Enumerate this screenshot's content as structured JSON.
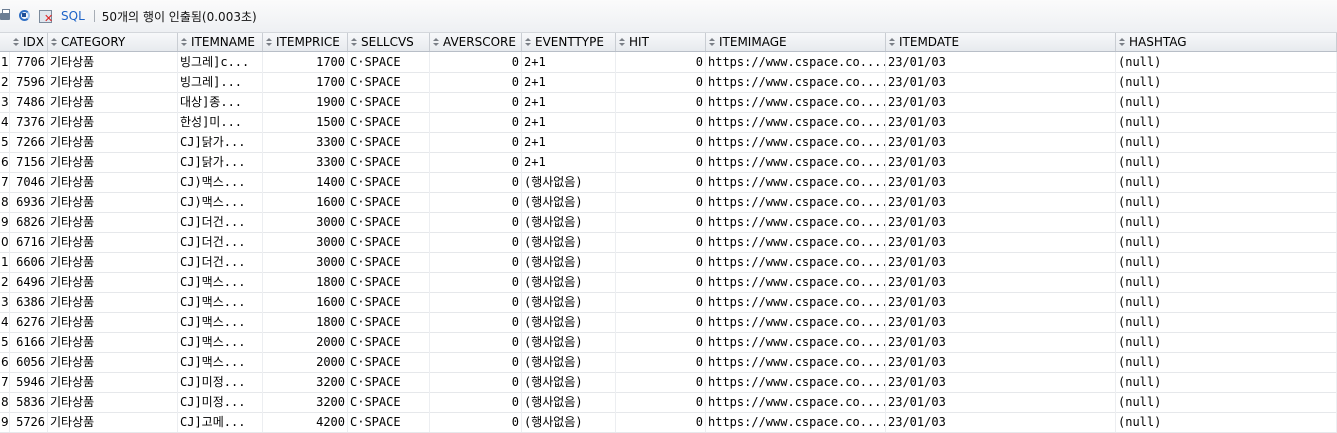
{
  "toolbar": {
    "print_icon": "print-icon",
    "refresh_icon": "refresh-icon",
    "cancel_icon": "cancel-icon",
    "sql_label": "SQL",
    "status_text": "50개의 행이 인출됨(0.003초)"
  },
  "columns": [
    "IDX",
    "CATEGORY",
    "ITEMNAME",
    "ITEMPRICE",
    "SELLCVS",
    "AVERSCORE",
    "EVENTTYPE",
    "HIT",
    "ITEMIMAGE",
    "ITEMDATE",
    "HASHTAG"
  ],
  "rows": [
    {
      "n": "1",
      "idx": "7706",
      "cat": "기타상품",
      "name": "빙그레]c...",
      "price": "1700",
      "cvs": "C·SPACE",
      "score": "0",
      "event": "2+1",
      "hit": "0",
      "img": "https://www.cspace.co....",
      "date": "23/01/03",
      "tag": "(null)"
    },
    {
      "n": "2",
      "idx": "7596",
      "cat": "기타상품",
      "name": "빙그레]...",
      "price": "1700",
      "cvs": "C·SPACE",
      "score": "0",
      "event": "2+1",
      "hit": "0",
      "img": "https://www.cspace.co....",
      "date": "23/01/03",
      "tag": "(null)"
    },
    {
      "n": "3",
      "idx": "7486",
      "cat": "기타상품",
      "name": "대상]종...",
      "price": "1900",
      "cvs": "C·SPACE",
      "score": "0",
      "event": "2+1",
      "hit": "0",
      "img": "https://www.cspace.co....",
      "date": "23/01/03",
      "tag": "(null)"
    },
    {
      "n": "4",
      "idx": "7376",
      "cat": "기타상품",
      "name": "한성]미...",
      "price": "1500",
      "cvs": "C·SPACE",
      "score": "0",
      "event": "2+1",
      "hit": "0",
      "img": "https://www.cspace.co....",
      "date": "23/01/03",
      "tag": "(null)"
    },
    {
      "n": "5",
      "idx": "7266",
      "cat": "기타상품",
      "name": "CJ]닭가...",
      "price": "3300",
      "cvs": "C·SPACE",
      "score": "0",
      "event": "2+1",
      "hit": "0",
      "img": "https://www.cspace.co....",
      "date": "23/01/03",
      "tag": "(null)"
    },
    {
      "n": "6",
      "idx": "7156",
      "cat": "기타상품",
      "name": "CJ]닭가...",
      "price": "3300",
      "cvs": "C·SPACE",
      "score": "0",
      "event": "2+1",
      "hit": "0",
      "img": "https://www.cspace.co....",
      "date": "23/01/03",
      "tag": "(null)"
    },
    {
      "n": "7",
      "idx": "7046",
      "cat": "기타상품",
      "name": "CJ)맥스...",
      "price": "1400",
      "cvs": "C·SPACE",
      "score": "0",
      "event": "(행사없음)",
      "hit": "0",
      "img": "https://www.cspace.co....",
      "date": "23/01/03",
      "tag": "(null)"
    },
    {
      "n": "8",
      "idx": "6936",
      "cat": "기타상품",
      "name": "CJ)맥스...",
      "price": "1600",
      "cvs": "C·SPACE",
      "score": "0",
      "event": "(행사없음)",
      "hit": "0",
      "img": "https://www.cspace.co....",
      "date": "23/01/03",
      "tag": "(null)"
    },
    {
      "n": "9",
      "idx": "6826",
      "cat": "기타상품",
      "name": "CJ]더건...",
      "price": "3000",
      "cvs": "C·SPACE",
      "score": "0",
      "event": "(행사없음)",
      "hit": "0",
      "img": "https://www.cspace.co....",
      "date": "23/01/03",
      "tag": "(null)"
    },
    {
      "n": "0",
      "idx": "6716",
      "cat": "기타상품",
      "name": "CJ]더건...",
      "price": "3000",
      "cvs": "C·SPACE",
      "score": "0",
      "event": "(행사없음)",
      "hit": "0",
      "img": "https://www.cspace.co....",
      "date": "23/01/03",
      "tag": "(null)"
    },
    {
      "n": "1",
      "idx": "6606",
      "cat": "기타상품",
      "name": "CJ]더건...",
      "price": "3000",
      "cvs": "C·SPACE",
      "score": "0",
      "event": "(행사없음)",
      "hit": "0",
      "img": "https://www.cspace.co....",
      "date": "23/01/03",
      "tag": "(null)"
    },
    {
      "n": "2",
      "idx": "6496",
      "cat": "기타상품",
      "name": "CJ]맥스...",
      "price": "1800",
      "cvs": "C·SPACE",
      "score": "0",
      "event": "(행사없음)",
      "hit": "0",
      "img": "https://www.cspace.co....",
      "date": "23/01/03",
      "tag": "(null)"
    },
    {
      "n": "3",
      "idx": "6386",
      "cat": "기타상품",
      "name": "CJ]맥스...",
      "price": "1600",
      "cvs": "C·SPACE",
      "score": "0",
      "event": "(행사없음)",
      "hit": "0",
      "img": "https://www.cspace.co....",
      "date": "23/01/03",
      "tag": "(null)"
    },
    {
      "n": "4",
      "idx": "6276",
      "cat": "기타상품",
      "name": "CJ]맥스...",
      "price": "1800",
      "cvs": "C·SPACE",
      "score": "0",
      "event": "(행사없음)",
      "hit": "0",
      "img": "https://www.cspace.co....",
      "date": "23/01/03",
      "tag": "(null)"
    },
    {
      "n": "5",
      "idx": "6166",
      "cat": "기타상품",
      "name": "CJ]맥스...",
      "price": "2000",
      "cvs": "C·SPACE",
      "score": "0",
      "event": "(행사없음)",
      "hit": "0",
      "img": "https://www.cspace.co....",
      "date": "23/01/03",
      "tag": "(null)"
    },
    {
      "n": "6",
      "idx": "6056",
      "cat": "기타상품",
      "name": "CJ]맥스...",
      "price": "2000",
      "cvs": "C·SPACE",
      "score": "0",
      "event": "(행사없음)",
      "hit": "0",
      "img": "https://www.cspace.co....",
      "date": "23/01/03",
      "tag": "(null)"
    },
    {
      "n": "7",
      "idx": "5946",
      "cat": "기타상품",
      "name": "CJ]미정...",
      "price": "3200",
      "cvs": "C·SPACE",
      "score": "0",
      "event": "(행사없음)",
      "hit": "0",
      "img": "https://www.cspace.co....",
      "date": "23/01/03",
      "tag": "(null)"
    },
    {
      "n": "8",
      "idx": "5836",
      "cat": "기타상품",
      "name": "CJ]미정...",
      "price": "3200",
      "cvs": "C·SPACE",
      "score": "0",
      "event": "(행사없음)",
      "hit": "0",
      "img": "https://www.cspace.co....",
      "date": "23/01/03",
      "tag": "(null)"
    },
    {
      "n": "9",
      "idx": "5726",
      "cat": "기타상품",
      "name": "CJ]고메...",
      "price": "4200",
      "cvs": "C·SPACE",
      "score": "0",
      "event": "(행사없음)",
      "hit": "0",
      "img": "https://www.cspace.co....",
      "date": "23/01/03",
      "tag": "(null)"
    }
  ]
}
